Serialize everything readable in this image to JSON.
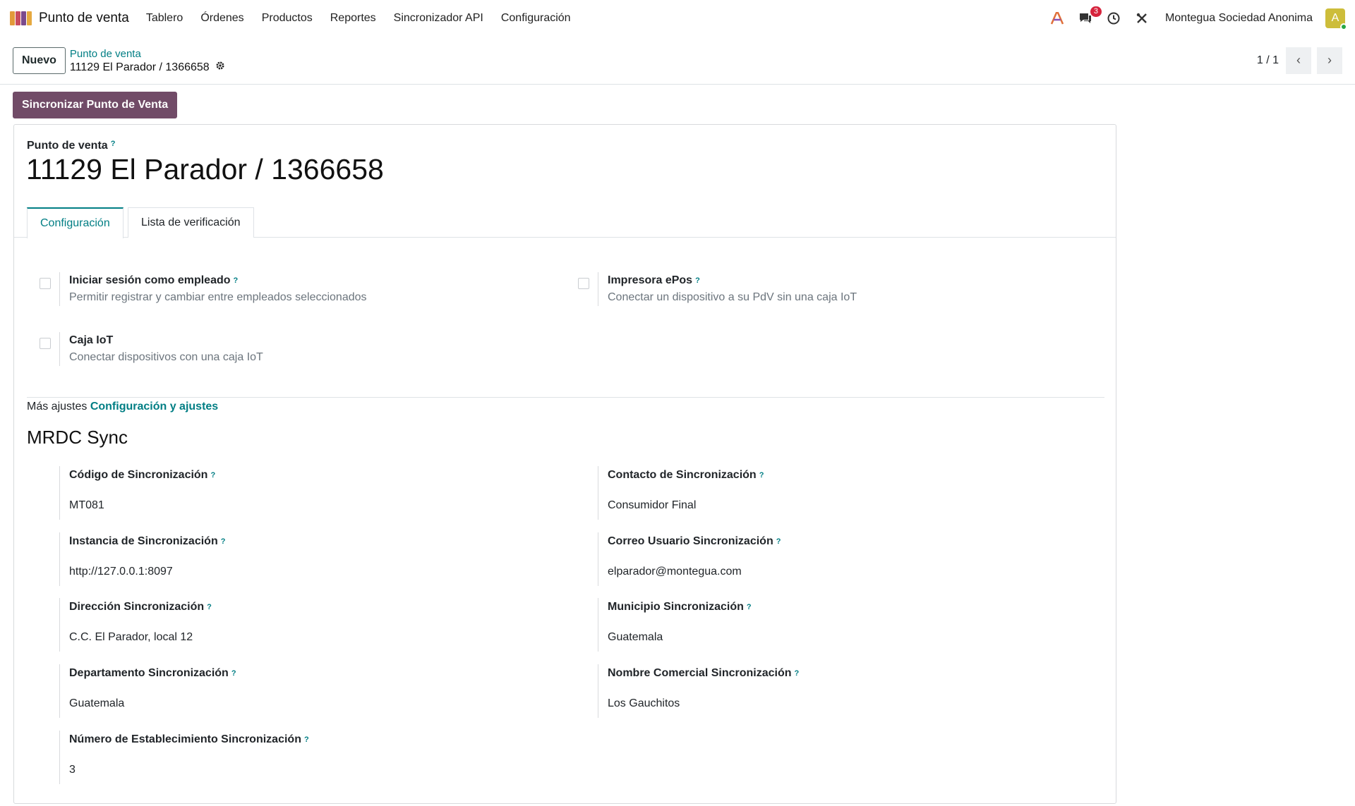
{
  "topnav": {
    "app_name": "Punto de venta",
    "menu": [
      "Tablero",
      "Órdenes",
      "Productos",
      "Reportes",
      "Sincronizador API",
      "Configuración"
    ],
    "chat_badge": "3",
    "company": "Montegua Sociedad Anonima",
    "avatar_letter": "A"
  },
  "control": {
    "new_button": "Nuevo",
    "breadcrumb": "Punto de venta",
    "record_name": "11129 El Parador / 1366658",
    "pager_value": "1 / 1"
  },
  "actions": {
    "sync_button": "Sincronizar Punto de Venta"
  },
  "sheet": {
    "label": "Punto de venta",
    "label_tooltip": "?",
    "title": "11129 El Parador / 1366658",
    "tabs": [
      "Configuración",
      "Lista de verificación"
    ],
    "settings": [
      {
        "title": "Iniciar sesión como empleado",
        "tooltip": "?",
        "desc": "Permitir registrar y cambiar entre empleados seleccionados"
      },
      {
        "title": "Impresora ePos",
        "tooltip": "?",
        "desc": "Conectar un dispositivo a su PdV sin una caja IoT"
      },
      {
        "title": "Caja IoT",
        "tooltip": "",
        "desc": "Conectar dispositivos con una caja IoT"
      }
    ],
    "more_settings_text": "Más ajustes",
    "more_settings_link": "Configuración y ajustes",
    "section_title": "MRDC Sync",
    "fields": [
      {
        "label": "Código de Sincronización",
        "tooltip": "?",
        "value": "MT081"
      },
      {
        "label": "Contacto de Sincronización",
        "tooltip": "?",
        "value": "Consumidor Final"
      },
      {
        "label": "Instancia de Sincronización",
        "tooltip": "?",
        "value": "http://127.0.0.1:8097"
      },
      {
        "label": "Correo Usuario Sincronización",
        "tooltip": "?",
        "value": "elparador@montegua.com"
      },
      {
        "label": "Dirección Sincronización",
        "tooltip": "?",
        "value": "C.C. El Parador, local 12"
      },
      {
        "label": "Municipio Sincronización",
        "tooltip": "?",
        "value": "Guatemala"
      },
      {
        "label": "Departamento Sincronización",
        "tooltip": "?",
        "value": "Guatemala"
      },
      {
        "label": "Nombre Comercial Sincronización",
        "tooltip": "?",
        "value": "Los Gauchitos"
      },
      {
        "label": "Número de Establecimiento Sincronización",
        "tooltip": "?",
        "value": "3"
      }
    ]
  },
  "colors": {
    "primary": "#714b67",
    "link": "#017e84",
    "badge": "#d6243d"
  }
}
